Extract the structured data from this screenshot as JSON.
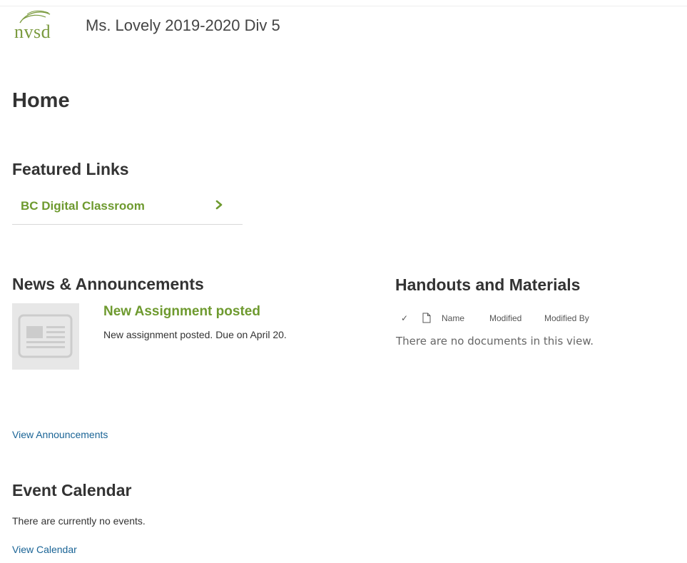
{
  "header": {
    "logo_text": "nvsd",
    "site_title": "Ms. Lovely 2019-2020 Div 5"
  },
  "page": {
    "title": "Home"
  },
  "featured_links": {
    "heading": "Featured Links",
    "items": [
      {
        "label": "BC Digital Classroom",
        "icon": "chevron-right-icon"
      }
    ]
  },
  "news": {
    "heading": "News & Announcements",
    "items": [
      {
        "title": "New Assignment posted",
        "body": "New assignment posted.  Due on April 20.",
        "thumbnail": "news-article-icon"
      }
    ],
    "view_link": "View Announcements"
  },
  "handouts": {
    "heading": "Handouts and Materials",
    "columns": {
      "check": "✓",
      "type": "document-icon",
      "name": "Name",
      "modified": "Modified",
      "modified_by": "Modified By"
    },
    "empty_message": "There are no documents in this view."
  },
  "calendar": {
    "heading": "Event Calendar",
    "empty_message": "There are currently no events.",
    "view_link": "View Calendar"
  },
  "colors": {
    "accent_green": "#6e9a2f",
    "link_blue": "#1a6496",
    "heading": "#333333"
  }
}
